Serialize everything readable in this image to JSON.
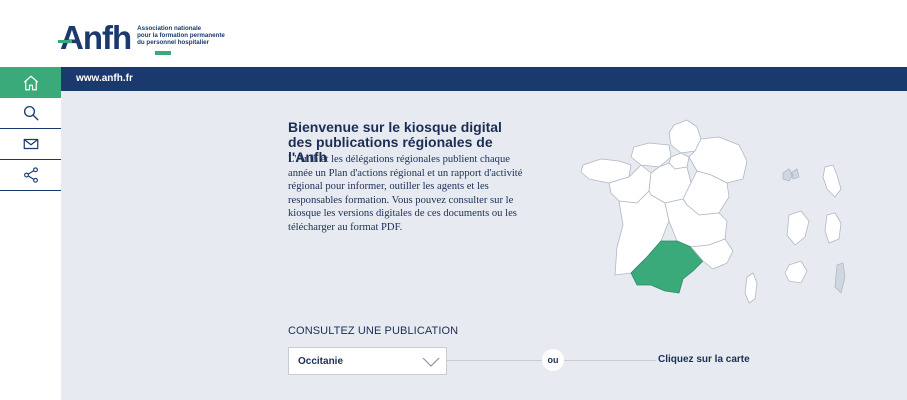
{
  "header": {
    "logo_prefix": "An",
    "logo_suffix": "fh",
    "tagline_1": "Association nationale",
    "tagline_2": "pour la formation permanente",
    "tagline_3": "du personnel hospitalier"
  },
  "sidebar": {
    "items": [
      {
        "icon": "home-icon",
        "active": true
      },
      {
        "icon": "search-icon",
        "active": false
      },
      {
        "icon": "mail-icon",
        "active": false
      },
      {
        "icon": "share-icon",
        "active": false
      }
    ]
  },
  "topbar": {
    "url": "www.anfh.fr"
  },
  "intro": {
    "title": "Bienvenue sur le kiosque digital des publications régionales de l'Anfh",
    "text": "L'Anfh et les délégations régionales publient chaque année un Plan d'actions régional et un rapport d'activité régional pour informer, outiller les agents et les responsables formation. Vous pouvez consulter sur le kiosque les versions digitales de ces documents ou les télécharger au format PDF."
  },
  "consult": {
    "label": "CONSULTEZ UNE PUBLICATION",
    "selected_region": "Occitanie",
    "or_label": "ou",
    "map_hint": "Cliquez sur la carte"
  },
  "colors": {
    "navy": "#1a3a6e",
    "green": "#3aaa7a",
    "background": "#e7ebf1"
  }
}
